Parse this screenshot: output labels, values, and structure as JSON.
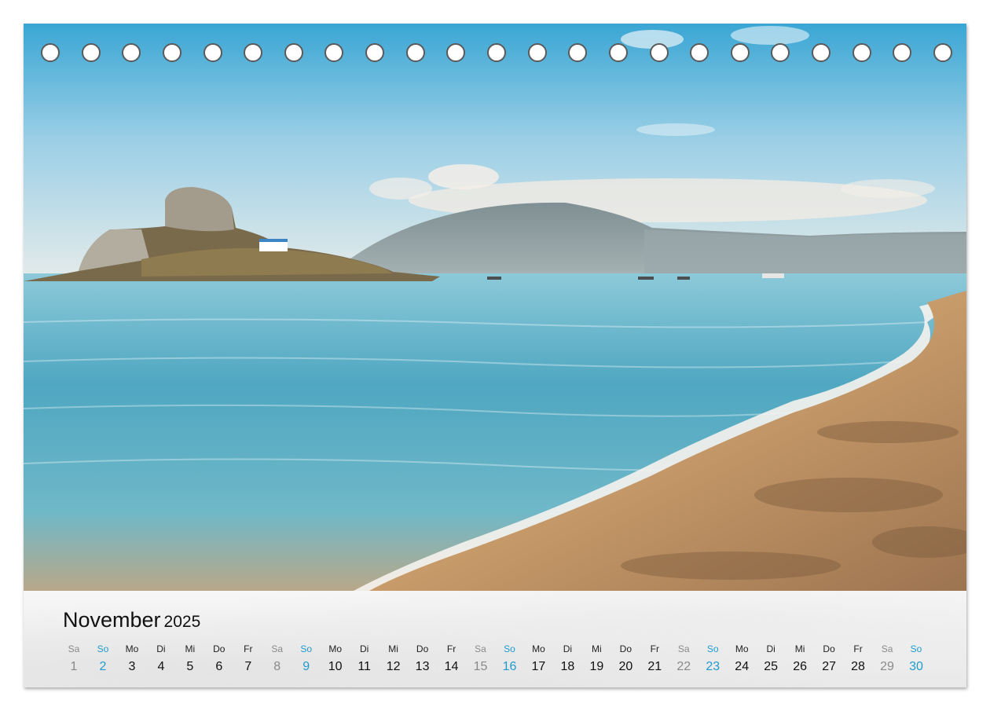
{
  "calendar": {
    "month": "November",
    "year": "2025",
    "days": [
      {
        "wd": "Sa",
        "d": "1",
        "kind": "sat"
      },
      {
        "wd": "So",
        "d": "2",
        "kind": "sun"
      },
      {
        "wd": "Mo",
        "d": "3",
        "kind": "day"
      },
      {
        "wd": "Di",
        "d": "4",
        "kind": "day"
      },
      {
        "wd": "Mi",
        "d": "5",
        "kind": "day"
      },
      {
        "wd": "Do",
        "d": "6",
        "kind": "day"
      },
      {
        "wd": "Fr",
        "d": "7",
        "kind": "day"
      },
      {
        "wd": "Sa",
        "d": "8",
        "kind": "sat"
      },
      {
        "wd": "So",
        "d": "9",
        "kind": "sun"
      },
      {
        "wd": "Mo",
        "d": "10",
        "kind": "day"
      },
      {
        "wd": "Di",
        "d": "11",
        "kind": "day"
      },
      {
        "wd": "Mi",
        "d": "12",
        "kind": "day"
      },
      {
        "wd": "Do",
        "d": "13",
        "kind": "day"
      },
      {
        "wd": "Fr",
        "d": "14",
        "kind": "day"
      },
      {
        "wd": "Sa",
        "d": "15",
        "kind": "sat"
      },
      {
        "wd": "So",
        "d": "16",
        "kind": "sun"
      },
      {
        "wd": "Mo",
        "d": "17",
        "kind": "day"
      },
      {
        "wd": "Di",
        "d": "18",
        "kind": "day"
      },
      {
        "wd": "Mi",
        "d": "19",
        "kind": "day"
      },
      {
        "wd": "Do",
        "d": "20",
        "kind": "day"
      },
      {
        "wd": "Fr",
        "d": "21",
        "kind": "day"
      },
      {
        "wd": "Sa",
        "d": "22",
        "kind": "sat"
      },
      {
        "wd": "So",
        "d": "23",
        "kind": "sun"
      },
      {
        "wd": "Mo",
        "d": "24",
        "kind": "day"
      },
      {
        "wd": "Di",
        "d": "25",
        "kind": "day"
      },
      {
        "wd": "Mi",
        "d": "26",
        "kind": "day"
      },
      {
        "wd": "Do",
        "d": "27",
        "kind": "day"
      },
      {
        "wd": "Fr",
        "d": "28",
        "kind": "day"
      },
      {
        "wd": "Sa",
        "d": "29",
        "kind": "sat"
      },
      {
        "wd": "So",
        "d": "30",
        "kind": "sun"
      }
    ]
  },
  "binding": {
    "ring_count": 23
  },
  "colors": {
    "sunday": "#1f9bcf",
    "saturday": "#8a8a8a",
    "weekday": "#111111"
  }
}
